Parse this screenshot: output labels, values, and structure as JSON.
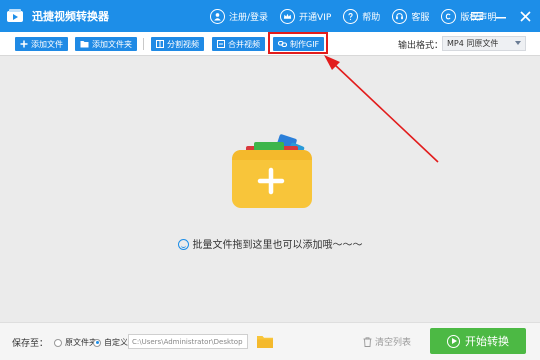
{
  "app": {
    "title": "迅捷视频转换器"
  },
  "title_actions": {
    "register": "注册/登录",
    "vip": "开通VIP",
    "help": "帮助",
    "service": "客服",
    "copyright": "版权声明"
  },
  "toolbar": {
    "add_file": "添加文件",
    "add_folder": "添加文件夹",
    "split_video": "分割视频",
    "merge_video": "合并视频",
    "make_gif": "制作GIF",
    "output_format_label": "输出格式：",
    "output_format_value": "MP4  同原文件"
  },
  "main": {
    "drop_hint": "批量文件拖到这里也可以添加哦～～～"
  },
  "footer": {
    "save_to_label": "保存至：",
    "radio_original": "原文件夹",
    "radio_custom": "自定义",
    "path_value": "C:\\Users\\Administrator\\Desktop",
    "clear_list": "清空列表",
    "start_convert": "开始转换"
  },
  "colors": {
    "primary": "#1d8ee8",
    "button_blue": "#1f8ae5",
    "start_green": "#4cb944",
    "highlight_red": "#e21c1c",
    "folder_yellow": "#f8c53a"
  }
}
